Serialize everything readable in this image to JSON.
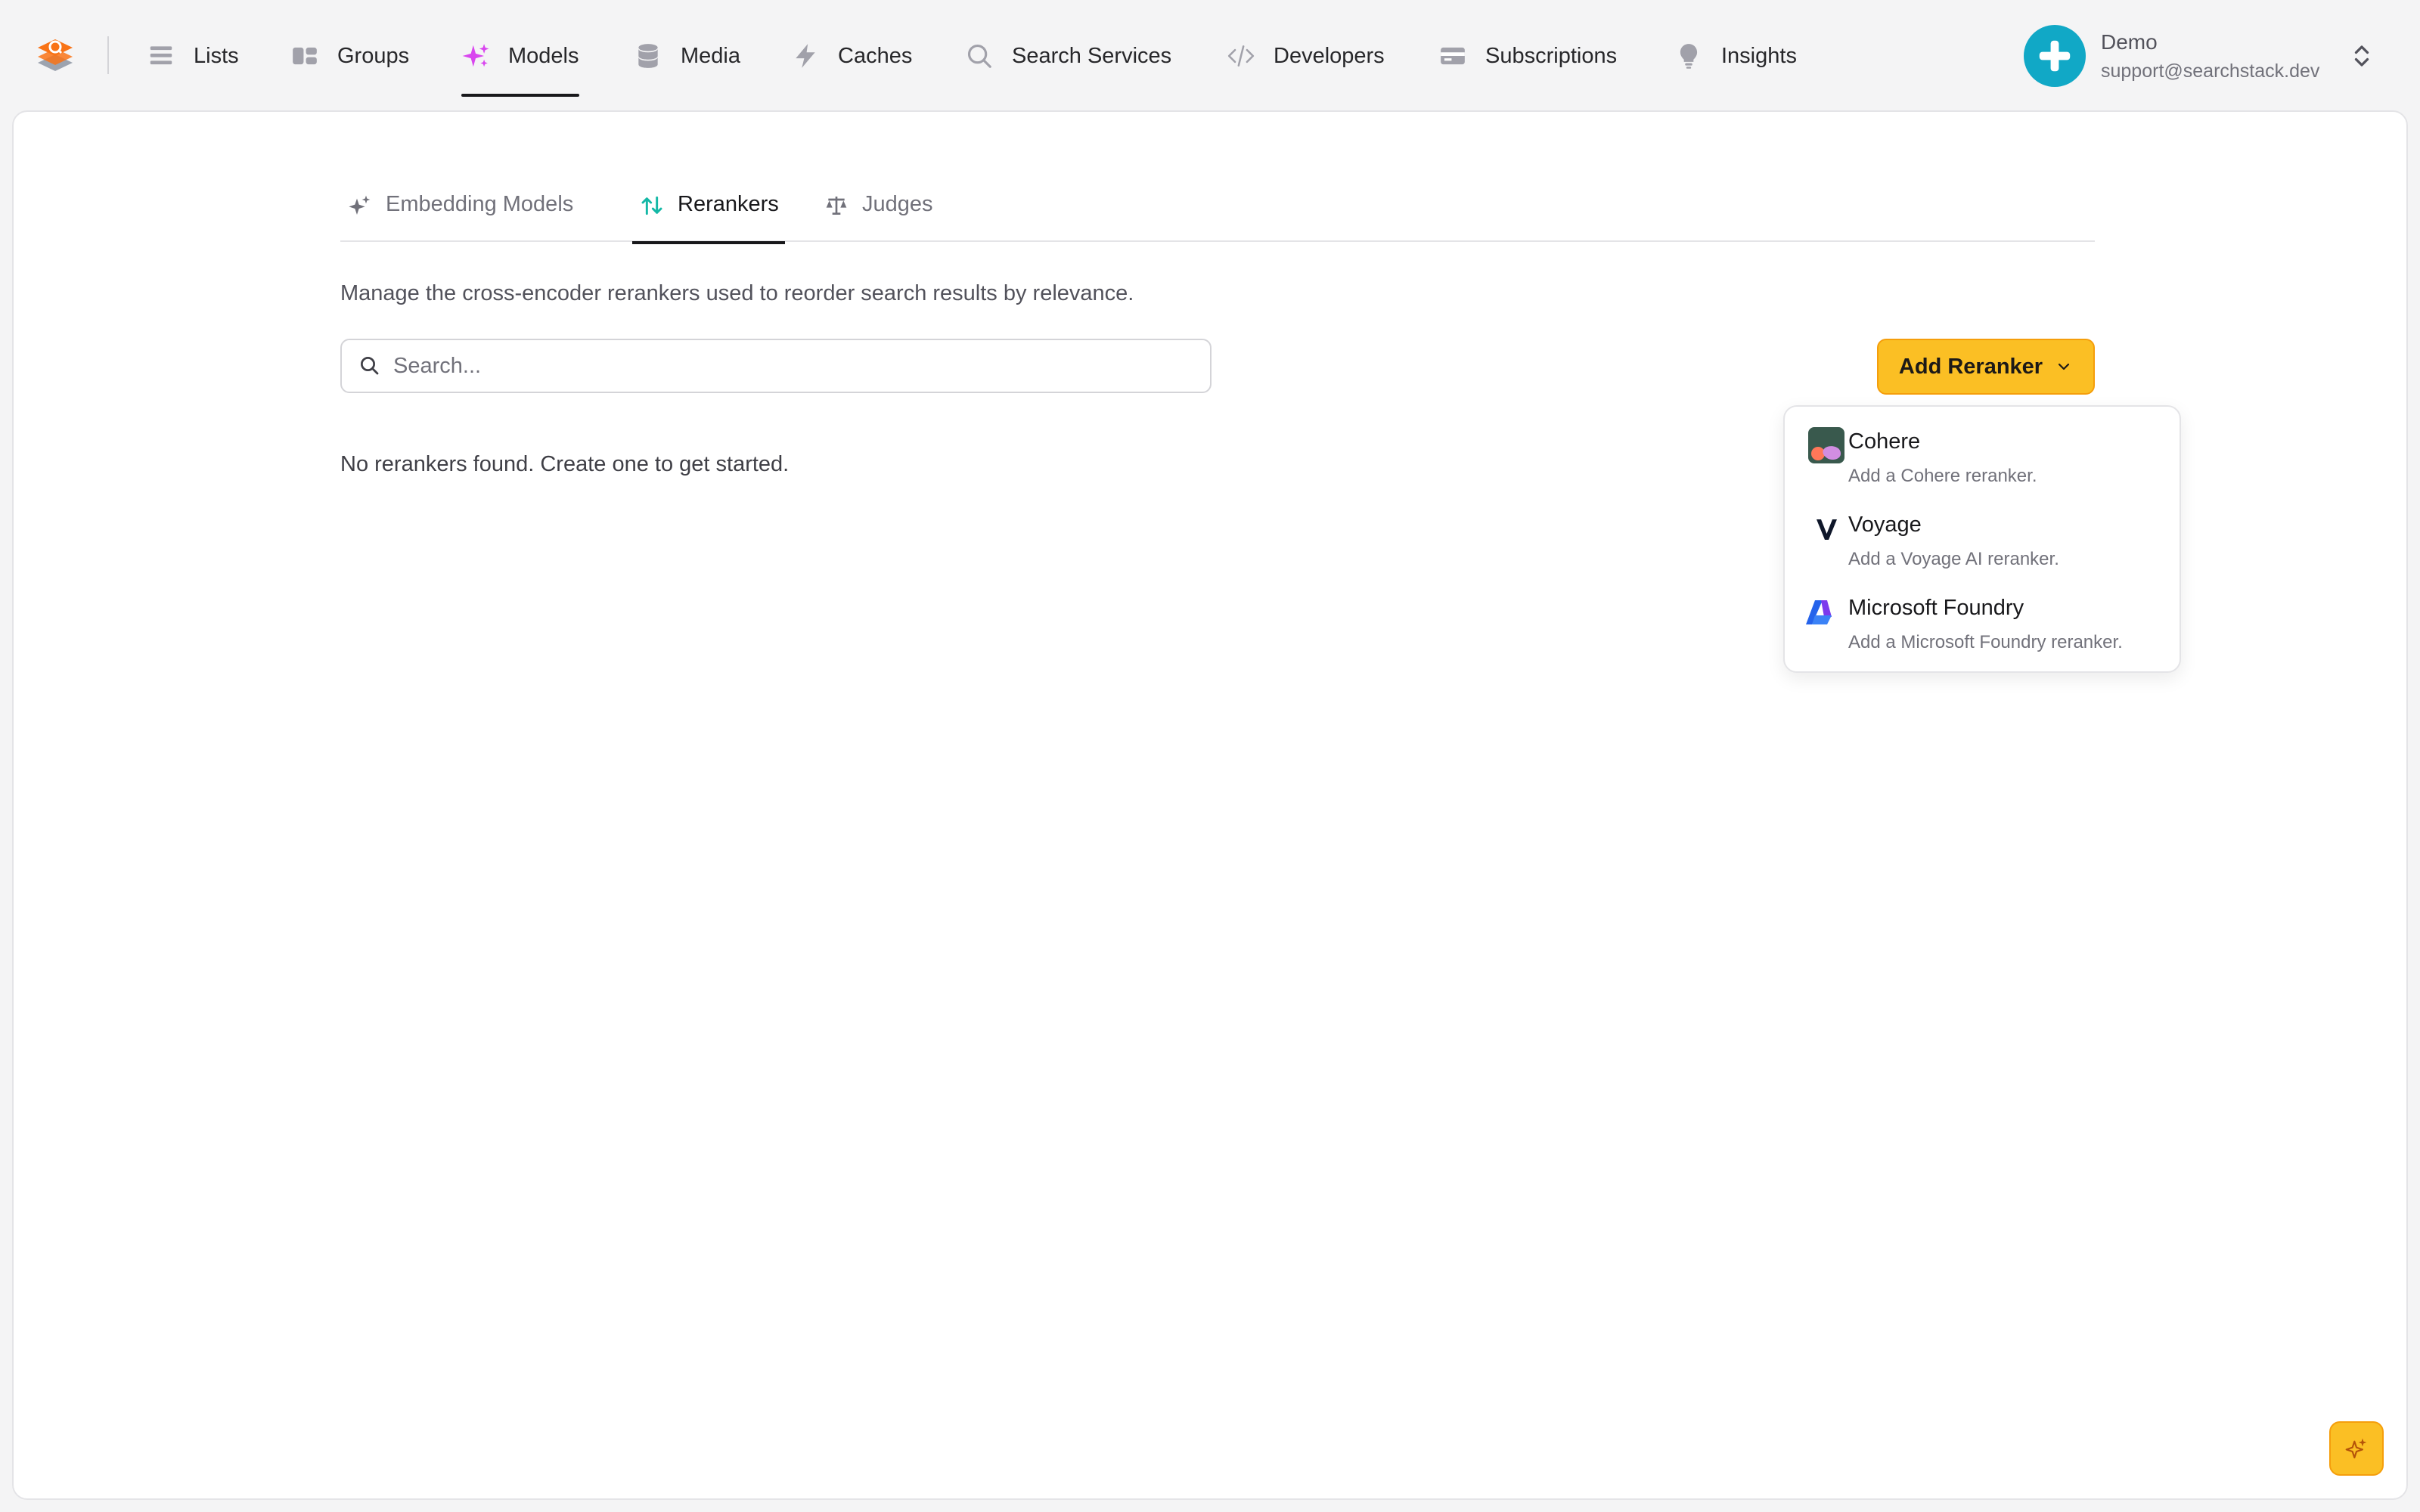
{
  "nav": {
    "items": [
      {
        "label": "Lists",
        "icon": "list-icon"
      },
      {
        "label": "Groups",
        "icon": "groups-icon"
      },
      {
        "label": "Models",
        "icon": "sparkles-icon",
        "active": true
      },
      {
        "label": "Media",
        "icon": "database-icon"
      },
      {
        "label": "Caches",
        "icon": "lightning-icon"
      },
      {
        "label": "Search Services",
        "icon": "search-icon"
      },
      {
        "label": "Developers",
        "icon": "code-icon"
      },
      {
        "label": "Subscriptions",
        "icon": "credit-card-icon"
      },
      {
        "label": "Insights",
        "icon": "lightbulb-icon"
      }
    ]
  },
  "user": {
    "name": "Demo",
    "email": "support@searchstack.dev",
    "avatar_color": "#11a8c6"
  },
  "tabs": [
    {
      "label": "Embedding Models",
      "icon": "sparkles-icon"
    },
    {
      "label": "Rerankers",
      "icon": "arrows-up-down-icon",
      "active": true
    },
    {
      "label": "Judges",
      "icon": "scale-icon"
    }
  ],
  "page": {
    "description": "Manage the cross-encoder rerankers used to reorder search results by relevance.",
    "search_placeholder": "Search...",
    "add_button_label": "Add Reranker",
    "empty_message": "No rerankers found. Create one to get started."
  },
  "dropdown": {
    "items": [
      {
        "title": "Cohere",
        "subtitle": "Add a Cohere reranker.",
        "icon": "cohere-logo-icon"
      },
      {
        "title": "Voyage",
        "subtitle": "Add a Voyage AI reranker.",
        "icon": "voyage-logo-icon"
      },
      {
        "title": "Microsoft Foundry",
        "subtitle": "Add a Microsoft Foundry reranker.",
        "icon": "microsoft-foundry-logo-icon"
      }
    ]
  },
  "colors": {
    "accent": "#fbbf24",
    "active_nav_icon": "#d946ef",
    "rerankers_tab_icon": "#14b8a6"
  }
}
